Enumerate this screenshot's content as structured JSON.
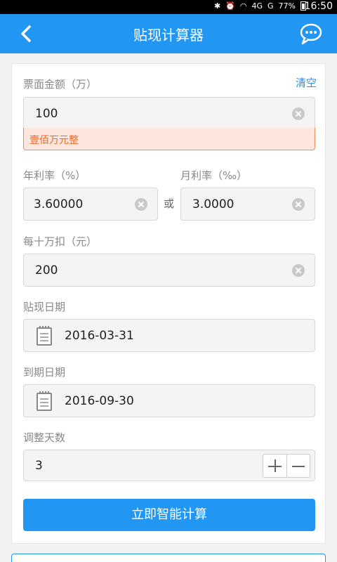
{
  "status_bar": {
    "time": "16:50",
    "battery": "77%",
    "network": "4G",
    "signal": "G"
  },
  "app_bar": {
    "title": "贴现计算器"
  },
  "amount": {
    "label": "票面金额（万）",
    "clear_label": "清空",
    "value": "100",
    "in_words": "壹佰万元整"
  },
  "annual_rate": {
    "label": "年利率（%）",
    "value": "3.60000"
  },
  "or_text": "或",
  "monthly_rate": {
    "label": "月利率（‰）",
    "value": "3.0000"
  },
  "deduction": {
    "label": "每十万扣（元）",
    "value": "200"
  },
  "discount_date": {
    "label": "贴现日期",
    "value": "2016-03-31"
  },
  "due_date": {
    "label": "到期日期",
    "value": "2016-09-30"
  },
  "adjust_days": {
    "label": "调整天数",
    "value": "3"
  },
  "calculate_button": "立即智能计算",
  "colors": {
    "primary": "#2196f3",
    "warning_bg": "#fde6dd",
    "warning_text": "#ee6a2a"
  }
}
